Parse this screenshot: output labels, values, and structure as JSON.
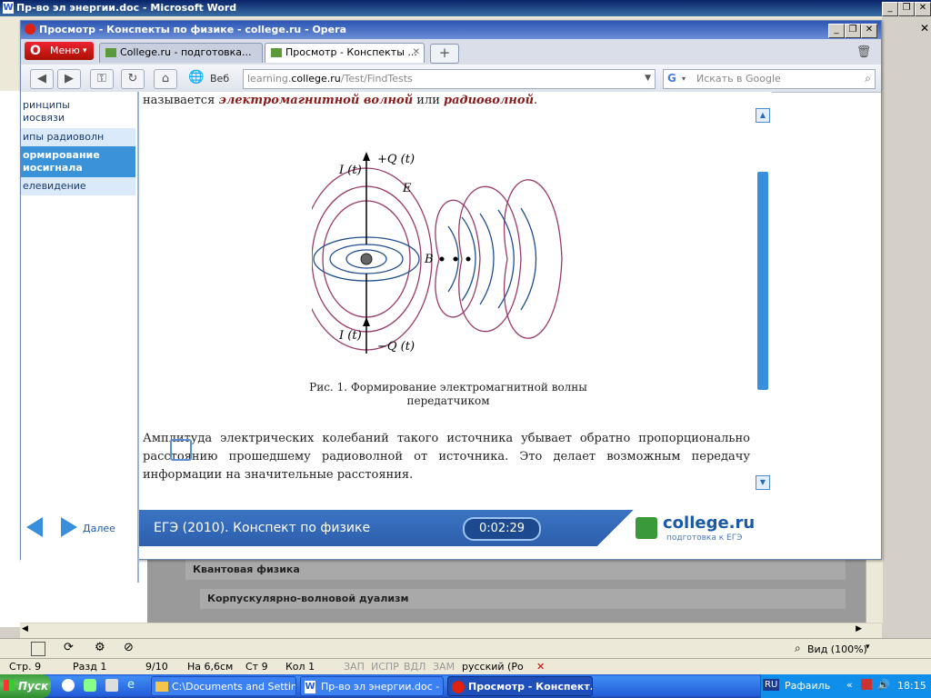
{
  "word": {
    "title": "Пр-во эл энергии.doc - Microsoft Word",
    "outline": [
      {
        "label": "Квантовая физика"
      },
      {
        "label": "Корпускулярно-волновой дуализм"
      }
    ],
    "status": {
      "page": "Стр. 9",
      "section": "Разд 1",
      "pages": "9/10",
      "at": "На 6,6см",
      "line": "Ст 9",
      "col": "Кол 1",
      "rec": "ЗАП",
      "trk": "ИСПР",
      "ext": "ВДЛ",
      "ovr": "ЗАМ",
      "lang": "русский (Ро"
    },
    "zoom_label": "Вид (100%)"
  },
  "opera": {
    "title": "Просмотр - Конспекты по физике - college.ru - Opera",
    "menu_label": "Меню",
    "tabs": [
      {
        "label": "College.ru - подготовка..."
      },
      {
        "label": "Просмотр - Конспекты ..."
      }
    ],
    "web_label": "Веб",
    "address": {
      "prefix": "learning.",
      "domain": "college.ru",
      "path": "/Test/FindTests"
    },
    "search_placeholder": "Искать в Google"
  },
  "sidebar": {
    "items": [
      {
        "label": "ринципы"
      },
      {
        "label": "иосвязи"
      },
      {
        "label": "ипы радиоволн"
      },
      {
        "label": "ормирование"
      },
      {
        "label": "иосигнала"
      },
      {
        "label": "елевидение"
      }
    ],
    "next_label": "Далее"
  },
  "content": {
    "para1_prefix": "называется",
    "para1_em1": "электромагнитной волной",
    "para1_mid": "или",
    "para1_em2": "радиоволной",
    "para1_end": ".",
    "fig_labels": {
      "it_top": "I (t)",
      "q_top": "+Q (t)",
      "e_vec": "E",
      "b_vec": "B",
      "it_bottom": "I (t)",
      "q_bottom": "−Q (t)"
    },
    "caption_line1": "Рис. 1. Формирование электромагнитной волны",
    "caption_line2": "передатчиком",
    "para2_line1": "Амплитуда электрических колебаний такого источника убывает обратно пропорционально",
    "para2_line2": "расстоянию прошедшему радиоволной от источника. Это делает возможным передачу",
    "para2_line3": "информации на значительные расстояния."
  },
  "footer": {
    "course": "ЕГЭ (2010). Конспект по физике",
    "timer": "0:02:29",
    "brand": "college.ru",
    "brand_sub": "подготовка к ЕГЭ"
  },
  "taskbar": {
    "start": "Пуск",
    "tasks": [
      {
        "label": "C:\\Documents and Settin..."
      },
      {
        "label": "Пр-во эл энергии.doc - ..."
      },
      {
        "label": "Просмотр - Конспект..."
      }
    ],
    "lang": "RU",
    "user": "Рафаиль",
    "clock": "18:15"
  }
}
